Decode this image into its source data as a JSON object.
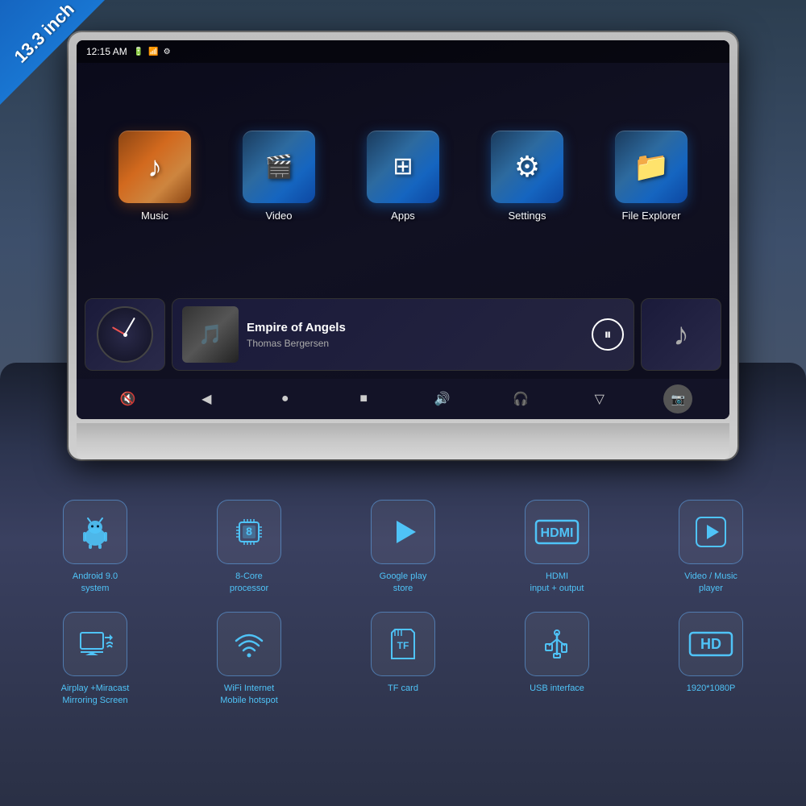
{
  "badge": {
    "text": "13.3 inch"
  },
  "screen": {
    "status_bar": {
      "time": "12:15 AM",
      "icons": [
        "🔋",
        "📶"
      ]
    },
    "apps": [
      {
        "id": "music",
        "label": "Music",
        "icon": "♪",
        "icon_class": "app-icon-music"
      },
      {
        "id": "video",
        "label": "Video",
        "icon": "🎬",
        "icon_class": "app-icon-video"
      },
      {
        "id": "apps",
        "label": "Apps",
        "icon": "⊞",
        "icon_class": "app-icon-apps"
      },
      {
        "id": "settings",
        "label": "Settings",
        "icon": "⚙",
        "icon_class": "app-icon-settings"
      },
      {
        "id": "files",
        "label": "File Explorer",
        "icon": "📁",
        "icon_class": "app-icon-files"
      }
    ],
    "music_player": {
      "track": "Empire of Angels",
      "artist": "Thomas Bergersen",
      "playing": true
    },
    "controls": [
      "🔇",
      "◀",
      "●",
      "■",
      "🔊",
      "🎧",
      "▽",
      "📷"
    ]
  },
  "features": {
    "row1": [
      {
        "id": "android",
        "icon": "🤖",
        "label": "Android 9.0\nsystem"
      },
      {
        "id": "processor",
        "icon": "8",
        "label": "8-Core\nprocessor"
      },
      {
        "id": "playstore",
        "icon": "▶",
        "label": "Google play\nstore"
      },
      {
        "id": "hdmi",
        "icon": "HDMI",
        "label": "HDMI\ninput + output"
      },
      {
        "id": "videoplayer",
        "icon": "▷",
        "label": "Video / Music\nplayer"
      }
    ],
    "row2": [
      {
        "id": "airplay",
        "icon": "↔",
        "label": "Airplay +Miracast\nMirroring Screen"
      },
      {
        "id": "wifi",
        "icon": "WiFi",
        "label": "WiFi Internet\nMobile hotspot"
      },
      {
        "id": "tfcard",
        "icon": "TF",
        "label": "TF card"
      },
      {
        "id": "usb",
        "icon": "USB",
        "label": "USB interface"
      },
      {
        "id": "hd",
        "icon": "HD",
        "label": "1920*1080P"
      }
    ]
  }
}
